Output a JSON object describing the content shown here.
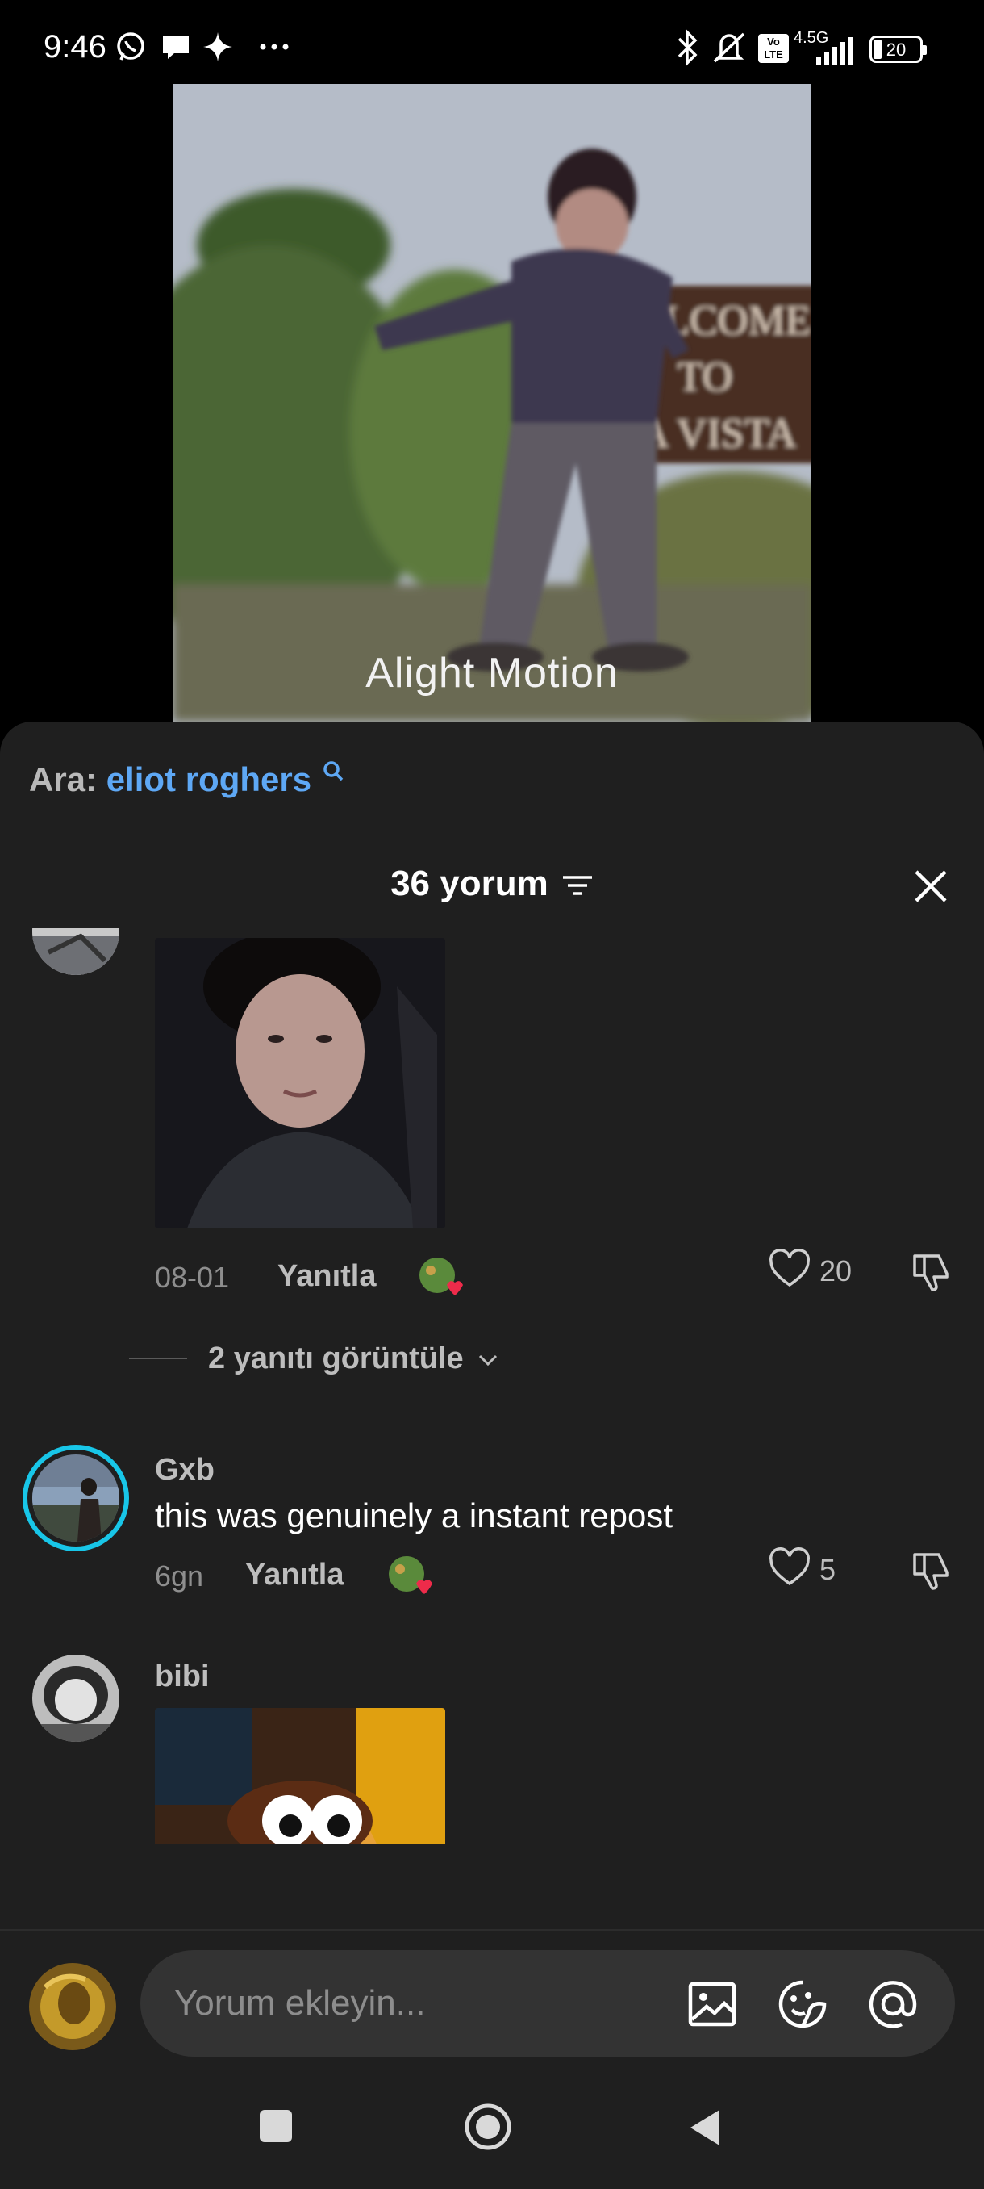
{
  "status_bar": {
    "time": "9:46",
    "network": "4.5G",
    "volte": "Vo LTE",
    "battery": "20"
  },
  "video": {
    "watermark": "Alight Motion",
    "sign_text": "WELCOME TO LA VISTA"
  },
  "search": {
    "prefix": "Ara:",
    "term": "eliot roghers"
  },
  "header": {
    "count_label": "36 yorum"
  },
  "comments": [
    {
      "username": "",
      "has_photo": true,
      "time": "08-01",
      "reply_label": "Yanıtla",
      "likes": "20",
      "view_replies": "2 yanıtı görüntüle"
    },
    {
      "username": "Gxb",
      "text": "this was genuinely a instant repost",
      "time": "6gn",
      "reply_label": "Yanıtla",
      "likes": "5"
    },
    {
      "username": "bibi",
      "has_photo": true
    }
  ],
  "input": {
    "placeholder": "Yorum ekleyin..."
  },
  "colors": {
    "accent_link": "#5ea8f5",
    "sheet_bg": "#1f1f1f",
    "input_bg": "#333333",
    "story_ring": "#18c6e8"
  }
}
